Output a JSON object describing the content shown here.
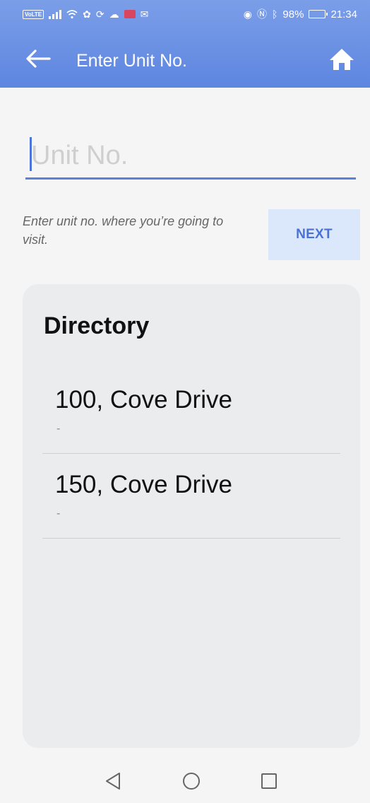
{
  "status_bar": {
    "volte": "VoLTE",
    "battery_percent": "98%",
    "time": "21:34"
  },
  "app_bar": {
    "title": "Enter Unit No.",
    "back_icon": "arrow-left-icon",
    "home_icon": "home-icon"
  },
  "unit_input": {
    "value": "",
    "placeholder": "Unit No."
  },
  "hint_text": "Enter unit no. where you’re going to visit.",
  "next_button": {
    "label": "NEXT"
  },
  "directory": {
    "title": "Directory",
    "items": [
      {
        "name": "100, Cove Drive",
        "sub": "-"
      },
      {
        "name": "150, Cove Drive",
        "sub": "-"
      }
    ]
  },
  "colors": {
    "app_bar": "#6a90e4",
    "accent": "#4a72d4",
    "next_bg": "#dbe7fb",
    "card_bg": "#eaecee"
  }
}
